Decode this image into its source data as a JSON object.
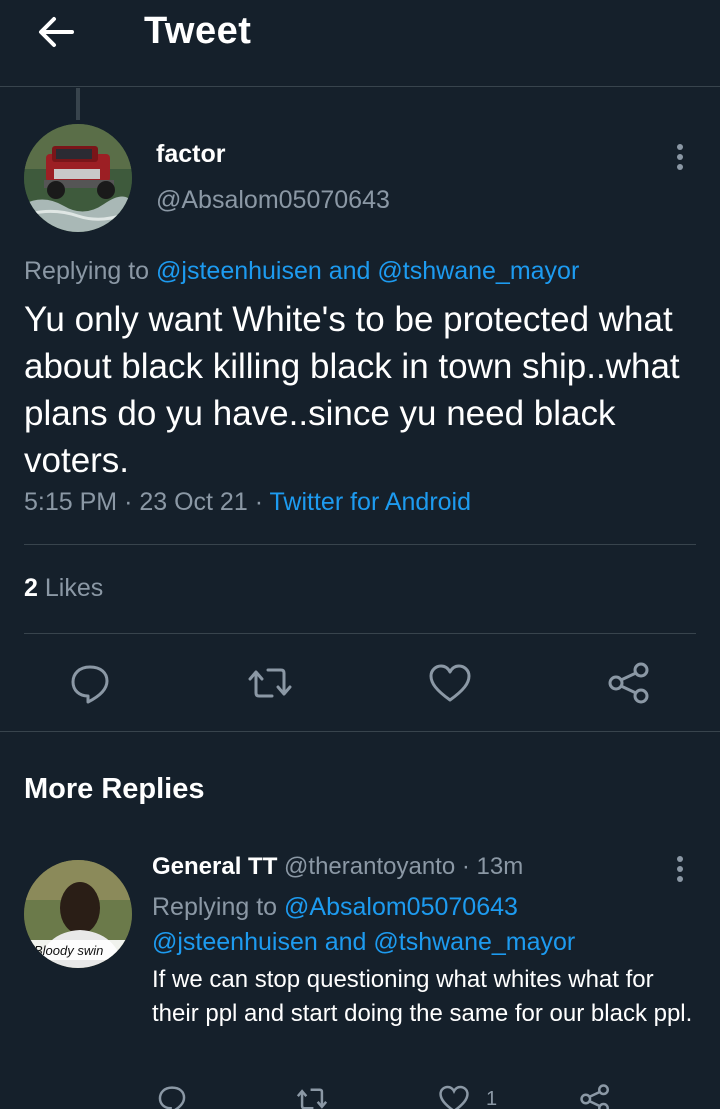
{
  "header": {
    "title": "Tweet"
  },
  "tweet": {
    "display_name": "factor",
    "handle": "@Absalom05070643",
    "replying_prefix": "Replying to",
    "replying_user1": "@jsteenhuisen",
    "replying_and": "and",
    "replying_user2": "@tshwane_mayor",
    "text": "Yu only want White's to be protected what about black killing black in town ship..what plans do yu have..since yu need black voters.",
    "time": "5:15 PM",
    "date": "23 Oct 21",
    "source": "Twitter for Android",
    "likes_count": "2",
    "likes_label": "Likes"
  },
  "more_replies": {
    "title": "More Replies"
  },
  "reply": {
    "display_name": "General TT",
    "handle": "@therantoyanto",
    "age": "13m",
    "replying_prefix": "Replying to",
    "replying_user1": "@Absalom05070643",
    "replying_user2": "@jsteenhuisen",
    "replying_and": "and",
    "replying_user3": "@tshwane_mayor",
    "text": "If we can stop questioning what whites what for their ppl and start doing the same for our black ppl.",
    "like_count": "1",
    "avatar_caption": "Bloody swin"
  },
  "colors": {
    "background": "#15202b",
    "accent": "#1d9bf0",
    "muted": "#8b98a5",
    "divider": "#38444d"
  },
  "icons": [
    "back-arrow-icon",
    "more-icon",
    "reply-icon",
    "retweet-icon",
    "like-icon",
    "share-icon"
  ]
}
